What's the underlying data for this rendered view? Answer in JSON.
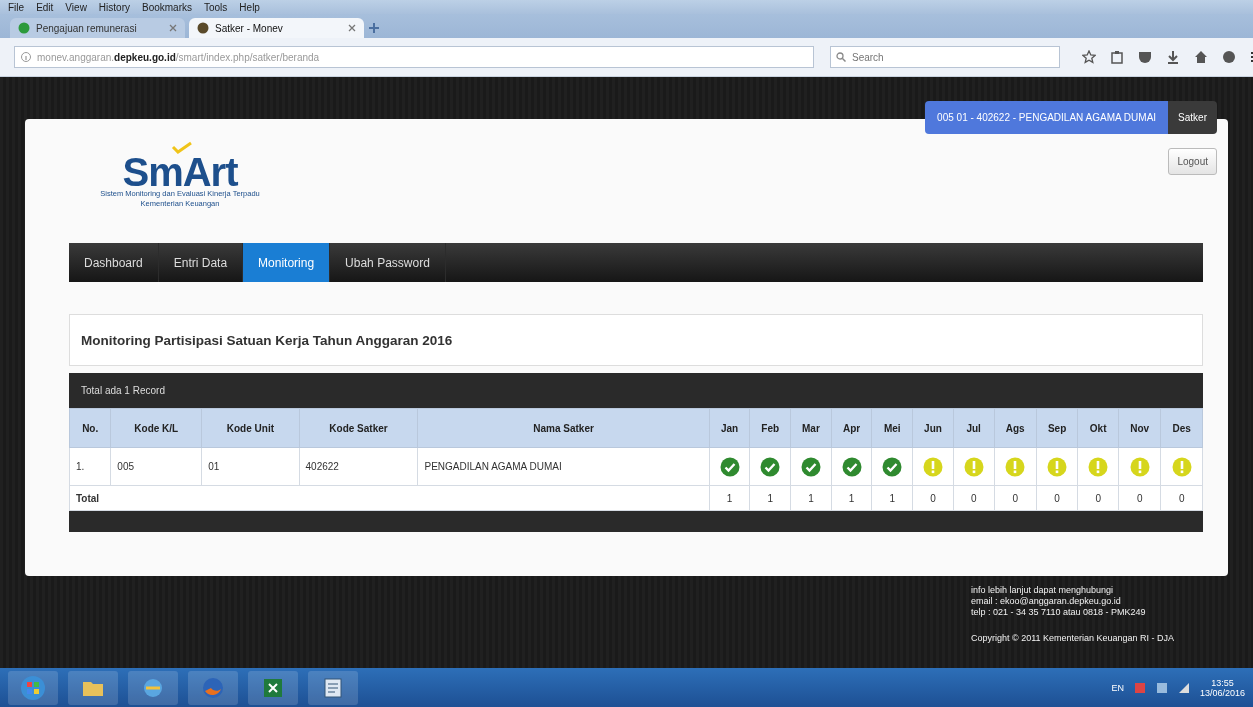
{
  "browser": {
    "menu": [
      "File",
      "Edit",
      "View",
      "History",
      "Bookmarks",
      "Tools",
      "Help"
    ],
    "tabs": [
      {
        "label": "Pengajuan remunerasi",
        "selected": false
      },
      {
        "label": "Satker - Monev",
        "selected": true
      }
    ],
    "url": "monev.anggaran.**depkeu.go.id**/smart/index.php/satker/beranda",
    "search": {
      "placeholder": "Search"
    }
  },
  "badge": {
    "unit": "005 01 - 402622 - PENGADILAN AGAMA DUMAI",
    "role": "Satker"
  },
  "logout": "Logout",
  "logo": {
    "name": "SmArt",
    "tagline": "Sistem Monitoring dan Evaluasi Kinerja Terpadu",
    "ministry": "Kementerian Keuangan"
  },
  "nav": [
    {
      "label": "Dashboard",
      "selected": false
    },
    {
      "label": "Entri Data",
      "selected": false
    },
    {
      "label": "Monitoring",
      "selected": true
    },
    {
      "label": "Ubah Password",
      "selected": false
    }
  ],
  "panel": {
    "title": "Monitoring Partisipasi Satuan Kerja Tahun Anggaran 2016"
  },
  "table": {
    "caption": "Total ada 1 Record",
    "columns": [
      "No.",
      "Kode K/L",
      "Kode Unit",
      "Kode Satker",
      "Nama Satker",
      "Jan",
      "Feb",
      "Mar",
      "Apr",
      "Mei",
      "Jun",
      "Jul",
      "Ags",
      "Sep",
      "Okt",
      "Nov",
      "Des"
    ],
    "rows": [
      {
        "cells": [
          "1.",
          "005",
          "01",
          "402622",
          "PENGADILAN AGAMA DUMAI"
        ],
        "months": [
          {
            "submitted": true
          },
          {
            "submitted": true
          },
          {
            "submitted": true
          },
          {
            "submitted": true
          },
          {
            "submitted": true
          },
          {
            "submitted": false
          },
          {
            "submitted": false
          },
          {
            "submitted": false
          },
          {
            "submitted": false
          },
          {
            "submitted": false
          },
          {
            "submitted": false
          },
          {
            "submitted": false
          }
        ]
      }
    ],
    "total": {
      "label": "Total",
      "values": [
        "1",
        "1",
        "1",
        "1",
        "1",
        "0",
        "0",
        "0",
        "0",
        "0",
        "0",
        "0"
      ]
    }
  },
  "footer": {
    "contact": [
      "info lebih lanjut dapat menghubungi",
      "email : ekoo@anggaran.depkeu.go.id",
      "telp : 021 - 34 35 7110 atau 0818 - PMK249"
    ],
    "copyright": "Copyright © 2011 Kementerian Keuangan RI - DJA"
  },
  "taskbar": {
    "language": "EN",
    "time": "13:55",
    "date": "13/06/2016"
  }
}
